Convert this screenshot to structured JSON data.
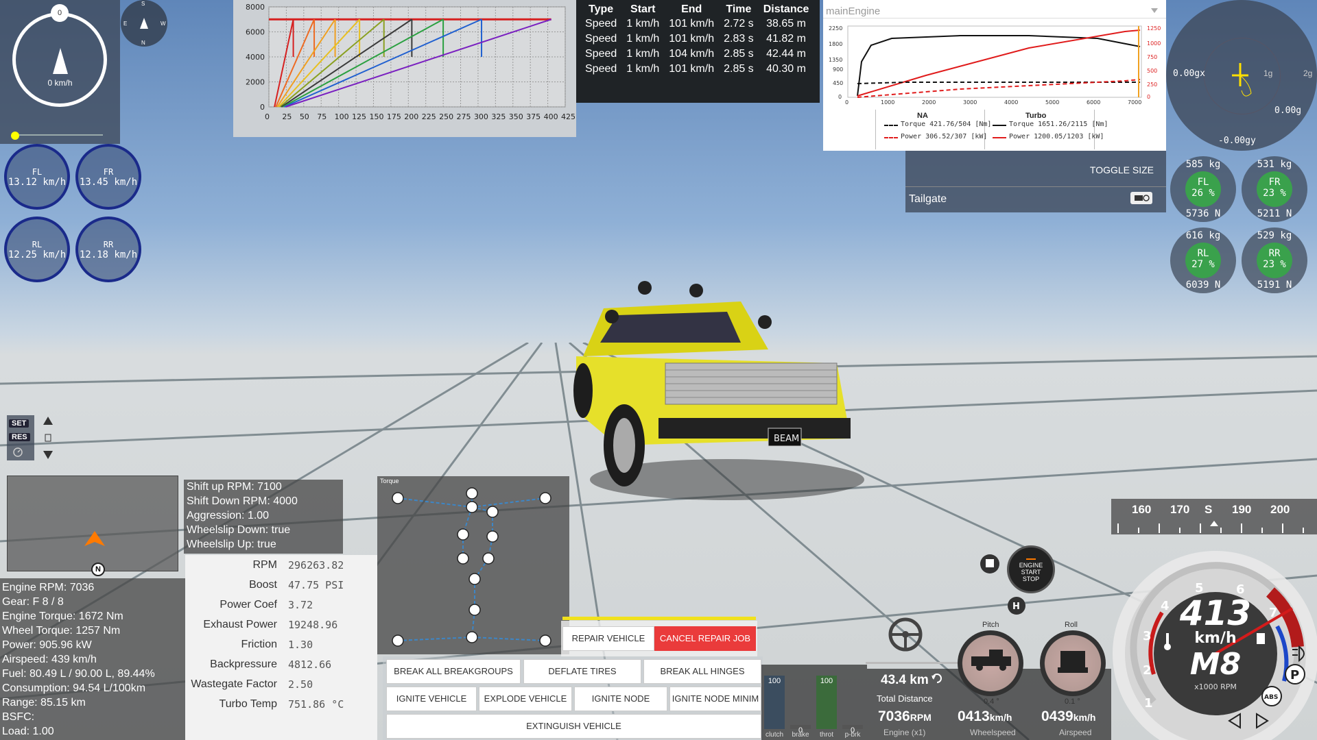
{
  "compass": {
    "top_label": "0",
    "speed": "0 km/h",
    "mini_s": "S",
    "mini_n": "N",
    "mini_e": "E",
    "mini_w": "W"
  },
  "wheels": [
    {
      "name": "FL",
      "speed": "13.12 km/h"
    },
    {
      "name": "FR",
      "speed": "13.45 km/h"
    },
    {
      "name": "RL",
      "speed": "12.25 km/h"
    },
    {
      "name": "RR",
      "speed": "12.18 km/h"
    }
  ],
  "chart_data": {
    "type": "line",
    "y_ticks": [
      "8000",
      "6000",
      "4000",
      "2000",
      "0"
    ],
    "x_ticks": [
      "0",
      "25",
      "50",
      "75",
      "100",
      "125",
      "150",
      "175",
      "200",
      "225",
      "250",
      "275",
      "300",
      "325",
      "350",
      "375",
      "400",
      "425"
    ],
    "xlim": [
      0,
      425
    ],
    "ylim": [
      0,
      8000
    ],
    "grid": true,
    "redline": 7000,
    "series": [
      {
        "color": "#d62020",
        "max_speed": 405,
        "shifts": [
          [
            0,
            0
          ],
          [
            80,
            7000
          ],
          [
            80,
            4000
          ]
        ]
      },
      {
        "color": "#ee6a22",
        "gears": [
          35,
          65,
          95,
          130,
          165,
          205,
          250,
          305,
          405
        ]
      }
    ]
  },
  "accel_table": {
    "headers": [
      "Type",
      "Start",
      "End",
      "Time",
      "Distance"
    ],
    "rows": [
      [
        "Speed",
        "1 km/h",
        "101 km/h",
        "2.72 s",
        "38.65 m"
      ],
      [
        "Speed",
        "1 km/h",
        "101 km/h",
        "2.83 s",
        "41.82 m"
      ],
      [
        "Speed",
        "1 km/h",
        "104 km/h",
        "2.85 s",
        "42.44 m"
      ],
      [
        "Speed",
        "1 km/h",
        "101 km/h",
        "2.85 s",
        "40.30 m"
      ]
    ]
  },
  "engine_chart": {
    "title": "mainEngine",
    "y_left_ticks": [
      "2250",
      "1800",
      "1350",
      "900",
      "450",
      "0"
    ],
    "y_right_ticks": [
      "1250",
      "1000",
      "750",
      "500",
      "250",
      "0"
    ],
    "x_ticks": [
      "0",
      "1000",
      "2000",
      "3000",
      "4000",
      "5000",
      "6000",
      "7000"
    ],
    "legend_na_title": "NA",
    "legend_turbo_title": "Turbo",
    "na_torque": "Torque 421.76/504 [Nm]",
    "na_power": "Power 306.52/307 [kW]",
    "turbo_torque": "Torque 1651.26/2115 [Nm]",
    "turbo_power": "Power 1200.05/1203 [kW]"
  },
  "toggle_panel": {
    "toggle_label": "TOGGLE SIZE",
    "tailgate_label": "Tailgate"
  },
  "accel_gauge": {
    "gx": "0.00gx",
    "g1": "1g",
    "g2": "2g",
    "g_val": "0.00g",
    "gy": "-0.00gy"
  },
  "tire_gauges": [
    {
      "name": "FL",
      "kg": "585 kg",
      "pct": "26 %",
      "n": "5736 N"
    },
    {
      "name": "FR",
      "kg": "531 kg",
      "pct": "23 %",
      "n": "5211 N"
    },
    {
      "name": "RL",
      "kg": "616 kg",
      "pct": "27 %",
      "n": "6039 N"
    },
    {
      "name": "RR",
      "kg": "529 kg",
      "pct": "23 %",
      "n": "5191 N"
    }
  ],
  "cruise": {
    "set": "SET",
    "res": "RES"
  },
  "minimap": {
    "north": "N"
  },
  "shift_info": [
    "Shift up RPM: 7100",
    "Shift Down RPM: 4000",
    "Aggression: 1.00",
    "Wheelslip Down: true",
    "Wheelslip Up: true"
  ],
  "stats": [
    "Engine RPM: 7036",
    "Gear: F 8 / 8",
    "Engine Torque: 1672 Nm",
    "Wheel Torque: 1257 Nm",
    "Power: 905.96 kW",
    "Airspeed: 439 km/h",
    "Fuel: 80.49 L / 90.00 L, 89.44%",
    "Consumption: 94.54 L/100km",
    "Range: 85.15 km",
    "BSFC:",
    "Load: 1.00"
  ],
  "params": [
    {
      "label": "RPM",
      "value": "296263.82"
    },
    {
      "label": "Boost",
      "value": "47.75 PSI"
    },
    {
      "label": "Power Coef",
      "value": "3.72"
    },
    {
      "label": "Exhaust Power",
      "value": "19248.96"
    },
    {
      "label": "Friction",
      "value": "1.30"
    },
    {
      "label": "Backpressure",
      "value": "4812.66"
    },
    {
      "label": "Wastegate Factor",
      "value": "2.50"
    },
    {
      "label": "Turbo Temp",
      "value": "751.86 °C"
    }
  ],
  "torque_tree": {
    "title": "Torque"
  },
  "buttons": {
    "repair": "REPAIR VEHICLE",
    "cancel_repair": "CANCEL REPAIR JOB",
    "break_groups": "BREAK ALL BREAKGROUPS",
    "deflate": "DEFLATE TIRES",
    "break_hinges": "BREAK ALL HINGES",
    "ignite_vehicle": "IGNITE VEHICLE",
    "explode": "EXPLODE VEHICLE",
    "ignite_node": "IGNITE NODE",
    "ignite_node_min": "IGNITE NODE MINIM",
    "extinguish": "EXTINGUISH VEHICLE"
  },
  "pedals": [
    {
      "label": "clutch",
      "value": "100",
      "color": "#3b4d5f"
    },
    {
      "label": "brake",
      "value": "0",
      "color": "#555555"
    },
    {
      "label": "throt",
      "value": "100",
      "color": "#3b6b3b"
    },
    {
      "label": "p-brk",
      "value": "0",
      "color": "#555555"
    }
  ],
  "bottom_info": {
    "distance": "43.4 km",
    "distance_label": "Total Distance",
    "engine_rpm": "7036",
    "engine_rpm_unit": "RPM",
    "engine_label": "Engine (x1)",
    "wheelspeed": "0413",
    "wheelspeed_unit": "km/h",
    "wheelspeed_label": "Wheelspeed",
    "airspeed": "0439",
    "airspeed_unit": "km/h",
    "airspeed_label": "Airspeed",
    "pitch_label": "Pitch",
    "pitch_val": "0.4 °",
    "roll_label": "Roll",
    "roll_val": "0.1 °"
  },
  "engine_button": {
    "l1": "ENGINE",
    "l2": "START",
    "l3": "STOP"
  },
  "heading_tape": [
    "160",
    "170",
    "S",
    "190",
    "200"
  ],
  "speedo": {
    "speed": "413",
    "unit": "km/h",
    "gear": "M8",
    "rpm_label": "x1000 RPM",
    "ticks": [
      "1",
      "2",
      "3",
      "4",
      "5",
      "6",
      "7"
    ],
    "abs": "ABS",
    "park": "P"
  },
  "car": {
    "plate": "BEAM"
  }
}
